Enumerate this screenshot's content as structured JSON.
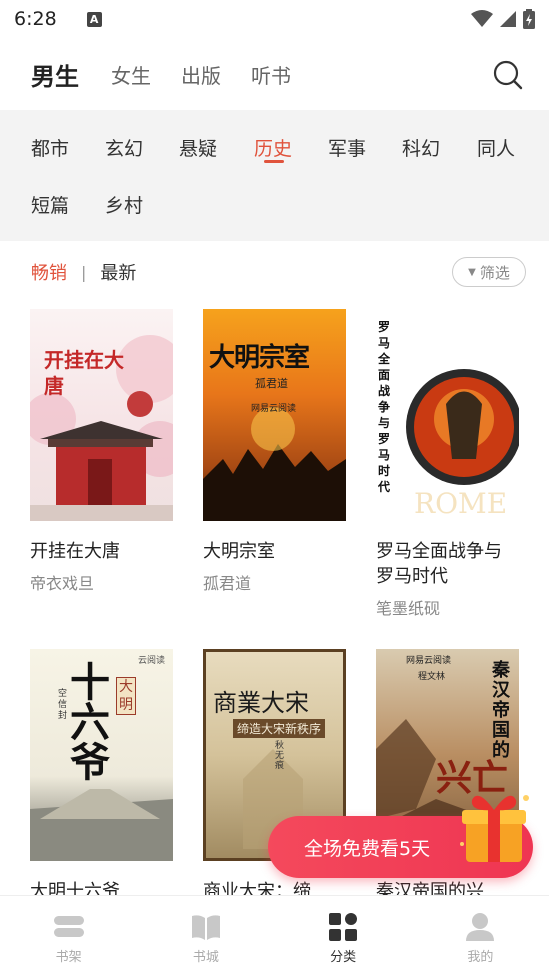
{
  "status_bar": {
    "time": "6:28",
    "notif_letter": "A"
  },
  "top_tabs": [
    "男生",
    "女生",
    "出版",
    "听书"
  ],
  "categories_row1": [
    "都市",
    "玄幻",
    "悬疑",
    "历史",
    "军事",
    "科幻",
    "同人"
  ],
  "categories_row2": [
    "短篇",
    "乡村"
  ],
  "active_category": "历史",
  "sort": {
    "active": "畅销",
    "separator": "|",
    "other": "最新"
  },
  "filter_label": "筛选",
  "books": [
    {
      "title": "开挂在大唐",
      "author": "帝衣戏旦",
      "cover_text": "开挂在大唐"
    },
    {
      "title": "大明宗室",
      "author": "孤君道",
      "cover_text": "大明宗室",
      "cover_sub": "孤君道",
      "cover_pub": "网易云阅读"
    },
    {
      "title": "罗马全面战争与罗马时代",
      "author": "笔墨纸砚",
      "cover_text": "罗马全面战争与罗马时代",
      "cover_sub": "ROME"
    },
    {
      "title": "大明十六爷",
      "author": "",
      "cover_text": "十六爷",
      "cover_sub": "大明",
      "cover_pub": "云阅读",
      "cover_author": "空信封"
    },
    {
      "title": "商业大宋：缔",
      "author": "",
      "cover_text": "商業大宋",
      "cover_sub": "缔造大宋新秩序",
      "cover_author": "秋无痕"
    },
    {
      "title": "秦汉帝国的兴",
      "author": "",
      "cover_text": "秦汉帝国的",
      "cover_sub": "兴亡",
      "cover_pub": "网易云阅读",
      "cover_author": "程文林"
    }
  ],
  "promo_text": "全场免费看5天",
  "bottom_nav": [
    {
      "label": "书架",
      "icon": "bookshelf-icon"
    },
    {
      "label": "书城",
      "icon": "book-store-icon"
    },
    {
      "label": "分类",
      "icon": "category-icon"
    },
    {
      "label": "我的",
      "icon": "profile-icon"
    }
  ],
  "active_nav": "分类",
  "colors": {
    "accent": "#e0533c",
    "promo": "#f03f55"
  }
}
